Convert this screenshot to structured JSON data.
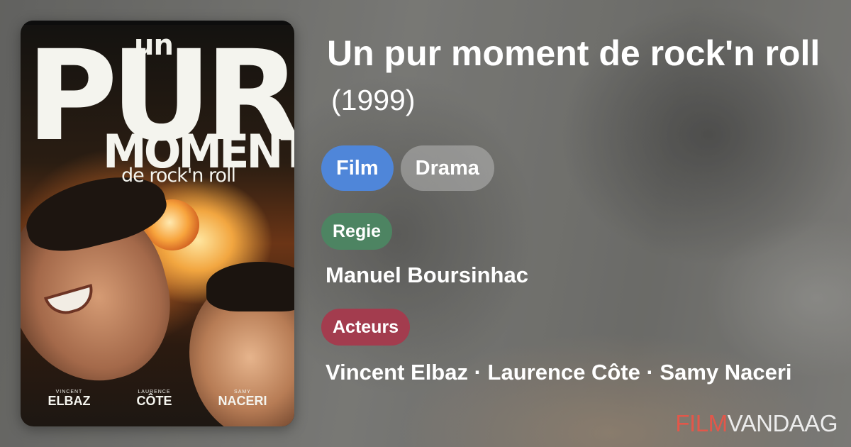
{
  "poster": {
    "title_line1": "un",
    "title_line2": "PUR",
    "title_line3": "MOMENT",
    "title_line4": "de rock'n roll",
    "cast": [
      {
        "first": "VINCENT",
        "last": "ELBAZ"
      },
      {
        "first": "LAURENCE",
        "last": "CÔTE"
      },
      {
        "first": "SAMY",
        "last": "NACERI"
      }
    ]
  },
  "movie": {
    "title": "Un pur moment de rock'n roll",
    "year": "(1999)"
  },
  "tags": {
    "type": "Film",
    "genre": "Drama"
  },
  "sections": {
    "director_label": "Regie",
    "director": "Manuel Boursinhac",
    "cast_label": "Acteurs",
    "cast": "Vincent Elbaz · Laurence Côte · Samy Naceri"
  },
  "brand": {
    "part1": "FILM",
    "part2": "VANDAAG"
  },
  "colors": {
    "film_tag": "#4f86d9",
    "regie_label": "#4d8462",
    "acteurs_label": "#a33c4e",
    "brand_accent": "#e2574a"
  }
}
